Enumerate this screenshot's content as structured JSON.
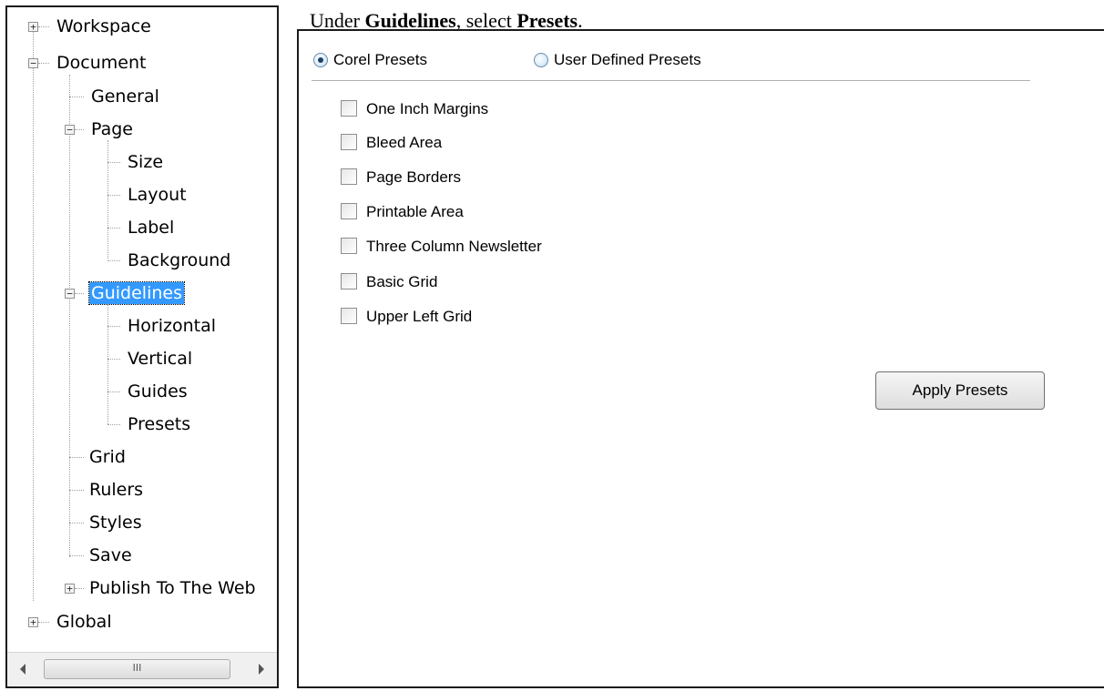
{
  "caption": {
    "prefix": "Under ",
    "section": "Guidelines",
    "middle": ", select ",
    "target": "Presets",
    "suffix": "."
  },
  "tree": {
    "expander_plus": "+",
    "expander_minus": "−",
    "items": [
      {
        "label": "Workspace",
        "expander": "plus"
      },
      {
        "label": "Document",
        "expander": "minus"
      },
      {
        "label": "General"
      },
      {
        "label": "Page",
        "expander": "minus"
      },
      {
        "label": "Size"
      },
      {
        "label": "Layout"
      },
      {
        "label": "Label"
      },
      {
        "label": "Background"
      },
      {
        "label": "Guidelines",
        "expander": "minus",
        "selected": true
      },
      {
        "label": "Horizontal"
      },
      {
        "label": "Vertical"
      },
      {
        "label": "Guides"
      },
      {
        "label": "Presets"
      },
      {
        "label": "Grid"
      },
      {
        "label": "Rulers"
      },
      {
        "label": "Styles"
      },
      {
        "label": "Save"
      },
      {
        "label": "Publish To The Web",
        "expander": "plus"
      },
      {
        "label": "Global",
        "expander": "plus"
      }
    ],
    "scrollbar_grip": "III"
  },
  "settings": {
    "preset_source": {
      "options": [
        "Corel Presets",
        "User Defined Presets"
      ],
      "selected": "Corel Presets"
    },
    "presets": [
      {
        "label": "One Inch Margins",
        "checked": false
      },
      {
        "label": "Bleed Area",
        "checked": false
      },
      {
        "label": "Page Borders",
        "checked": false
      },
      {
        "label": "Printable Area",
        "checked": false
      },
      {
        "label": "Three Column Newsletter",
        "checked": false
      },
      {
        "label": "Basic Grid",
        "checked": false
      },
      {
        "label": "Upper Left Grid",
        "checked": false
      }
    ],
    "apply_button_label": "Apply Presets"
  },
  "colors": {
    "selection": "#3399ff",
    "panel_border": "#1a1a1a"
  }
}
